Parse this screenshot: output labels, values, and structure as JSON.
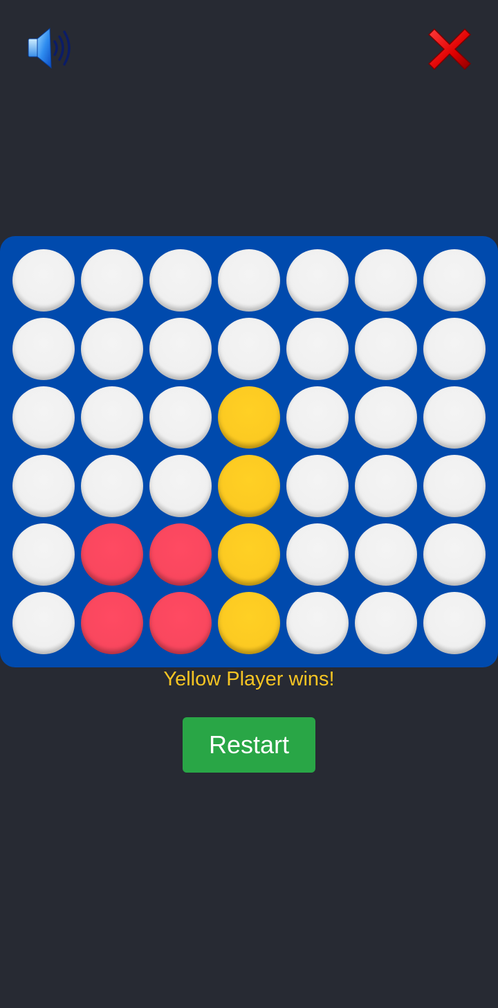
{
  "header": {
    "sound_icon": "speaker-volume-icon",
    "close_icon": "close-x-icon"
  },
  "board": {
    "rows": 6,
    "columns": 7,
    "cells": [
      [
        "empty",
        "empty",
        "empty",
        "empty",
        "empty",
        "empty",
        "empty"
      ],
      [
        "empty",
        "empty",
        "empty",
        "empty",
        "empty",
        "empty",
        "empty"
      ],
      [
        "empty",
        "empty",
        "empty",
        "yellow",
        "empty",
        "empty",
        "empty"
      ],
      [
        "empty",
        "empty",
        "empty",
        "yellow",
        "empty",
        "empty",
        "empty"
      ],
      [
        "empty",
        "red",
        "red",
        "yellow",
        "empty",
        "empty",
        "empty"
      ],
      [
        "empty",
        "red",
        "red",
        "yellow",
        "empty",
        "empty",
        "empty"
      ]
    ]
  },
  "status": {
    "message": "Yellow Player wins!"
  },
  "controls": {
    "restart_label": "Restart"
  },
  "colors": {
    "background": "#272a33",
    "board": "#004aad",
    "empty": "#f0f0f0",
    "yellow": "#fcca22",
    "red": "#f9475e",
    "status_text": "#f5c423",
    "restart_button": "#29a646"
  }
}
